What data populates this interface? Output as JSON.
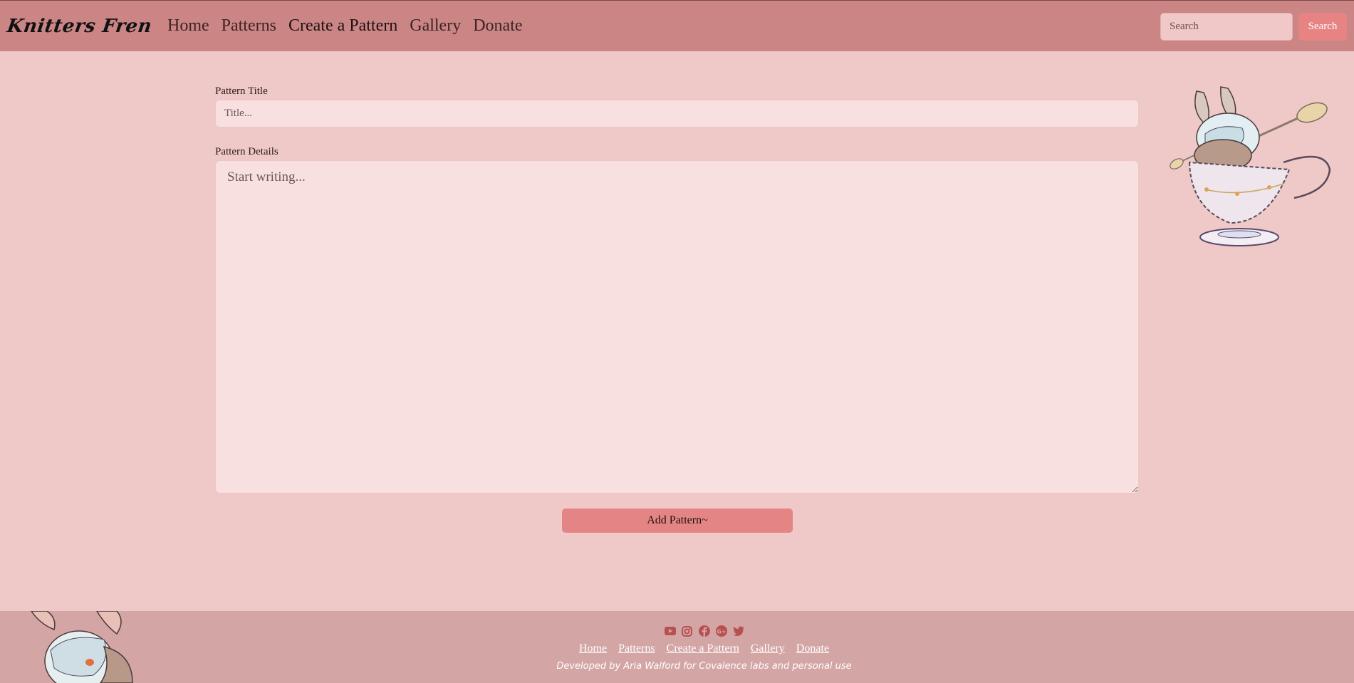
{
  "navbar": {
    "brand": "Knitters Fren",
    "links": [
      "Home",
      "Patterns",
      "Create a Pattern",
      "Gallery",
      "Donate"
    ],
    "search_placeholder": "Search",
    "search_button": "Search"
  },
  "form": {
    "title_label": "Pattern Title",
    "title_placeholder": "Title...",
    "details_label": "Pattern Details",
    "details_placeholder": "Start writing...",
    "submit_label": "Add Pattern~"
  },
  "footer": {
    "social_icons": [
      "youtube-icon",
      "instagram-icon",
      "facebook-icon",
      "google-plus-icon",
      "twitter-icon"
    ],
    "links": [
      "Home",
      "Patterns",
      "Create a Pattern",
      "Gallery",
      "Donate"
    ],
    "credit": "Developed by Aria Walford for Covalence labs and personal use"
  },
  "colors": {
    "background": "#efc8c8",
    "navbar": "#cb8585",
    "accent_button": "#e48484",
    "input_bg": "#f8e0e0",
    "footer": "#d4a5a5",
    "social_icon": "#b85050"
  }
}
